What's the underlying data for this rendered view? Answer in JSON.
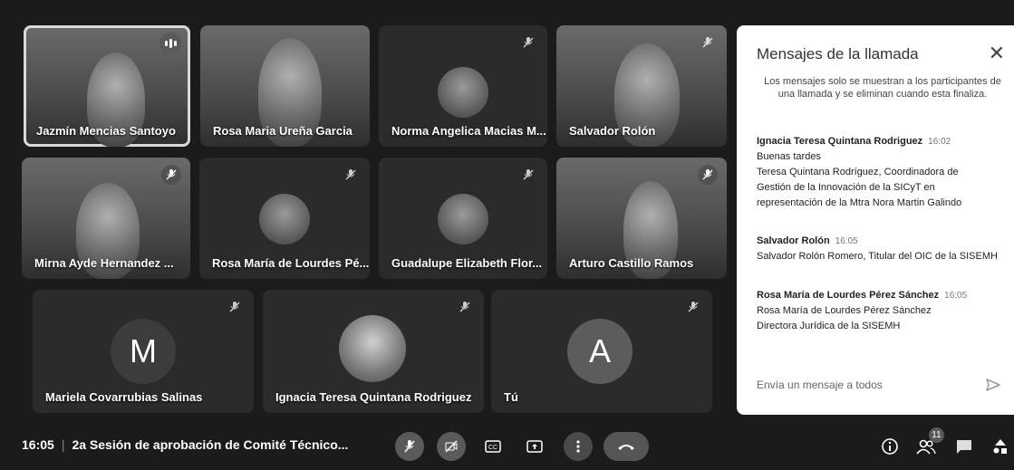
{
  "participants": [
    {
      "name": "Jazmín Mencias Santoyo"
    },
    {
      "name": "Rosa Maria Ureña Garcia"
    },
    {
      "name": "Norma Angelica Macias M..."
    },
    {
      "name": "Salvador Rolón"
    },
    {
      "name": "Mirna Ayde Hernandez ..."
    },
    {
      "name": "Rosa María de Lourdes Pé..."
    },
    {
      "name": "Guadalupe Elizabeth Flor..."
    },
    {
      "name": "Arturo Castillo Ramos"
    },
    {
      "name": "Mariela Covarrubias Salinas",
      "initial": "M"
    },
    {
      "name": "Ignacia Teresa Quintana Rodriguez"
    },
    {
      "name": "Tú",
      "initial": "A"
    }
  ],
  "chat": {
    "title": "Mensajes de la llamada",
    "note": "Los mensajes solo se muestran a los participantes de una llamada y se eliminan cuando esta finaliza.",
    "messages": [
      {
        "sender": "Ignacia Teresa Quintana Rodriguez",
        "time": "16:02",
        "lines": [
          "Buenas tardes",
          "Teresa Quintana Rodríguez, Coordinadora de",
          "Gestión de la Innovación de la SICyT en",
          "representación de la Mtra Nora Martin Galindo"
        ]
      },
      {
        "sender": "Salvador Rolón",
        "time": "16:05",
        "lines": [
          "Salvador Rolón Romero, Titular del OIC de la SISEMH"
        ]
      },
      {
        "sender": "Rosa María de Lourdes Pérez Sánchez",
        "time": "16:05",
        "lines": [
          "Rosa María de Lourdes Pérez Sánchez",
          "Directora Jurídica de la SISEMH"
        ]
      }
    ],
    "input_placeholder": "Envía un mensaje a todos"
  },
  "meeting": {
    "time": "16:05",
    "separator": "|",
    "title": "2a Sesión de aprobación de Comité Técnico..."
  },
  "people_count": "11",
  "colors": {
    "avatar_m": "#3c3c3c",
    "avatar_a": "#5c5c5c",
    "panel_bg": "#ffffff",
    "page_bg": "#1b1b1b"
  }
}
